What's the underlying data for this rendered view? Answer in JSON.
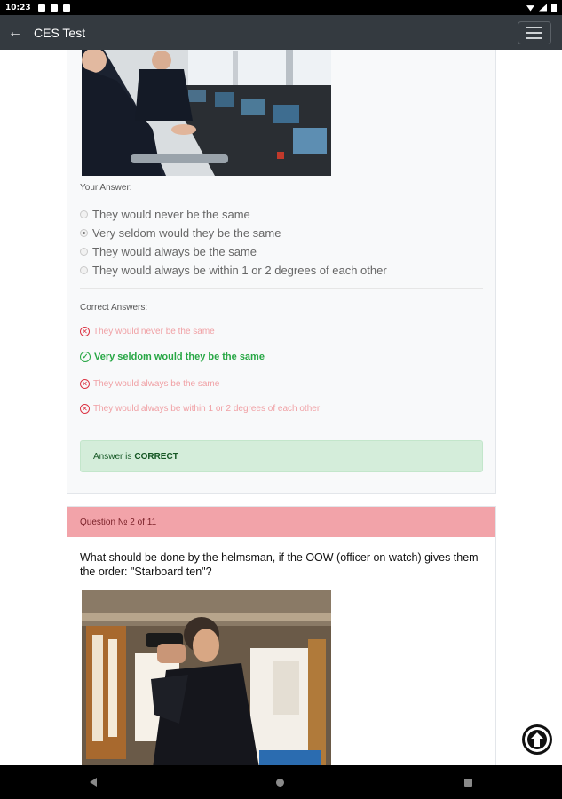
{
  "status_bar": {
    "time": "10:23"
  },
  "app_bar": {
    "title": "CES Test",
    "back_icon": "arrow-left-icon",
    "menu_icon": "hamburger-menu-icon"
  },
  "question1": {
    "your_answer_label": "Your Answer:",
    "options": [
      {
        "label": "They would never be the same",
        "selected": false
      },
      {
        "label": "Very seldom would they be the same",
        "selected": true
      },
      {
        "label": "They would always be the same",
        "selected": false
      },
      {
        "label": "They would always be within 1 or 2 degrees of each other",
        "selected": false
      }
    ],
    "correct_answers_label": "Correct Answers:",
    "correct_answers": [
      {
        "label": "They would never be the same",
        "correct": false
      },
      {
        "label": "Very seldom would they be the same",
        "correct": true
      },
      {
        "label": "They would always be the same",
        "correct": false
      },
      {
        "label": "They would always be within 1 or 2 degrees of each other",
        "correct": false
      }
    ],
    "result_prefix": "Answer is",
    "result_value": "CORRECT"
  },
  "question2": {
    "header": "Question № 2 of 11",
    "text": "What should be done by the helmsman, if the OOW (officer on watch) gives them the order: \"Starboard ten\"?"
  },
  "colors": {
    "app_bar": "#343a40",
    "correct": "#28a745",
    "wrong": "#dc3545",
    "result_bg": "#d4edda",
    "question_header_bg": "#f2a3a9"
  }
}
